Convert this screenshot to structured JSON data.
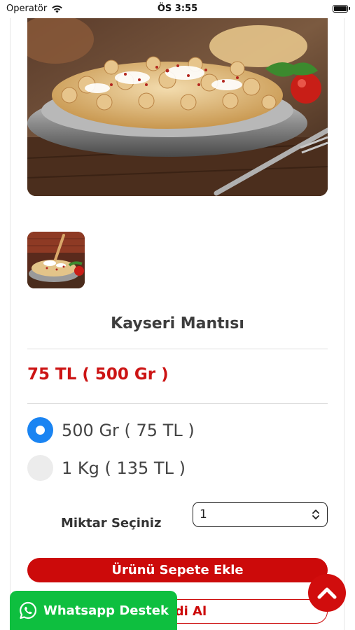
{
  "status_bar": {
    "carrier": "Operatör",
    "time": "ÖS 3:55",
    "wifi_icon": "wifi-icon",
    "battery_icon": "battery-icon"
  },
  "product": {
    "main_image_alt": "Kayseri Mantısı photo",
    "title": "Kayseri Mantısı",
    "price": "75 TL ( 500 Gr )"
  },
  "options": [
    {
      "label": "500 Gr ( 75 TL )",
      "selected": true
    },
    {
      "label": "1 Kg ( 135 TL )",
      "selected": false
    }
  ],
  "quantity": {
    "label": "Miktar Seçiniz",
    "value": "1"
  },
  "actions": {
    "add_to_cart": "Ürünü Sepete Ekle",
    "buy_now": "Şimdi Al"
  },
  "whatsapp": {
    "label": "Whatsapp Destek",
    "icon": "whatsapp-icon"
  },
  "scroll_top": {
    "icon": "chevron-up-icon"
  },
  "colors": {
    "accent_red": "#cc0a0a",
    "radio_blue": "#1a84f2",
    "whatsapp_green": "#0ebf3f"
  }
}
